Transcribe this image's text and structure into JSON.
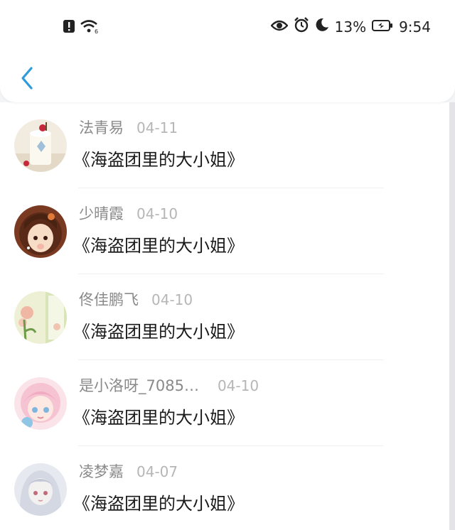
{
  "status_bar": {
    "icons_left": [
      "alert-icon",
      "wifi-icon"
    ],
    "icons_right": [
      "eye-icon",
      "alarm-icon",
      "moon-icon"
    ],
    "battery_percent": "13%",
    "time": "9:54"
  },
  "colors": {
    "accent": "#2e9bdc",
    "name_gray": "#8a8a8a",
    "date_gray": "#b6b6b6",
    "title_dark": "#1a1a1a"
  },
  "items": [
    {
      "name": "法青易",
      "date": "04-11",
      "title": "《海盗团里的大小姐》",
      "avatar_icon": "cake-avatar"
    },
    {
      "name": "少晴霞",
      "date": "04-10",
      "title": "《海盗团里的大小姐》",
      "avatar_icon": "anime-girl-avatar"
    },
    {
      "name": "佟佳鹏飞",
      "date": "04-10",
      "title": "《海盗团里的大小姐》",
      "avatar_icon": "flower-window-avatar"
    },
    {
      "name": "是小洛呀_7085…",
      "date": "04-10",
      "title": "《海盗团里的大小姐》",
      "avatar_icon": "pink-anime-avatar"
    },
    {
      "name": "凌梦嘉",
      "date": "04-07",
      "title": "《海盗团里的大小姐》",
      "avatar_icon": "silver-hair-avatar"
    }
  ]
}
